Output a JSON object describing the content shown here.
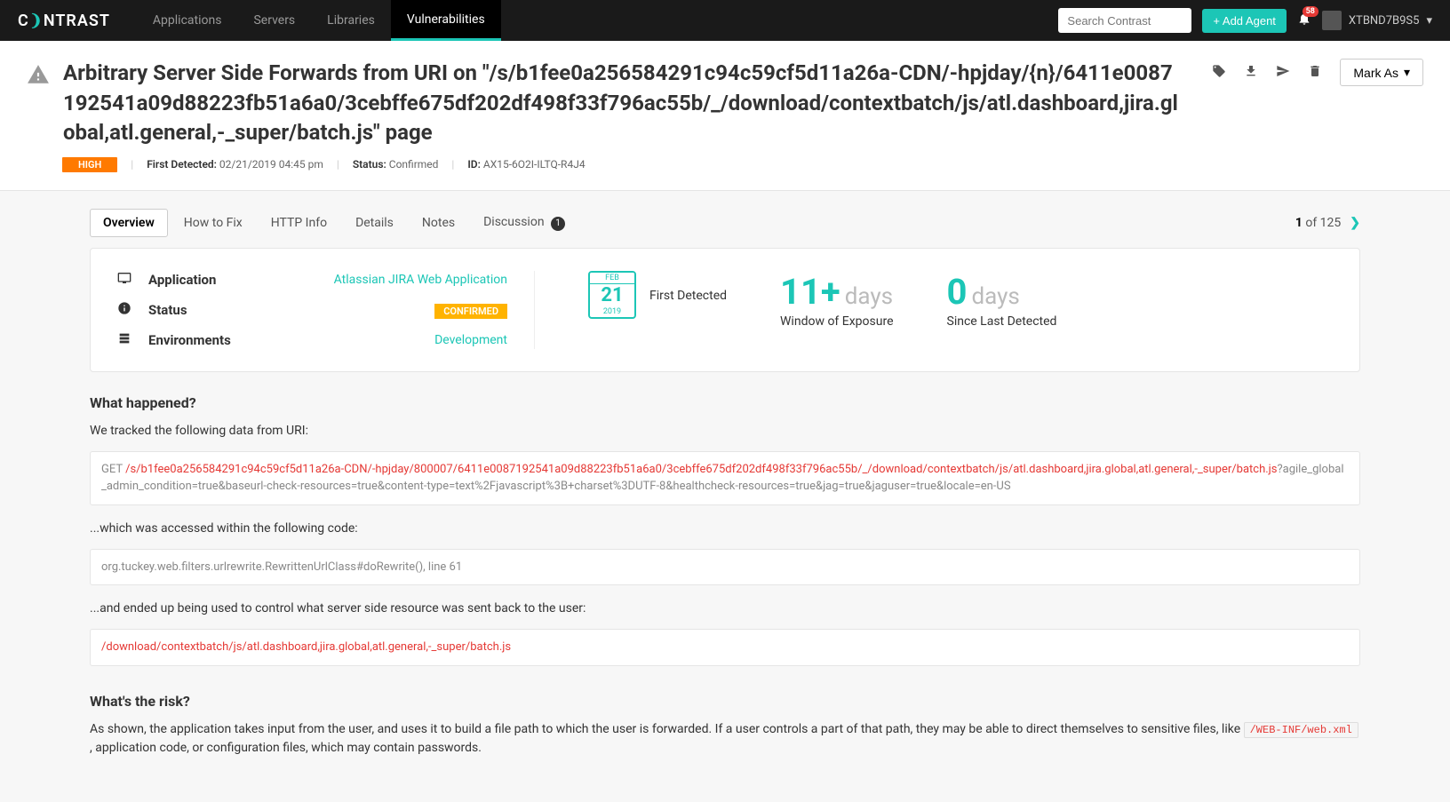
{
  "nav": {
    "logo_pre": "C",
    "logo_accent": "❩",
    "logo_post": "NTRAST",
    "items": [
      "Applications",
      "Servers",
      "Libraries",
      "Vulnerabilities"
    ],
    "active_index": 3,
    "search_placeholder": "Search Contrast",
    "add_agent": "+ Add Agent",
    "notif_count": "58",
    "username": "XTBND7B9S5"
  },
  "header": {
    "title": "Arbitrary Server Side Forwards from URI on \"/s/b1fee0a256584291c94c59cf5d11a26a-CDN/-hpjday/{n}/6411e0087192541a09d88223fb51a6a0/3cebffe675df202df498f33f796ac55b/_/download/contextbatch/js/atl.dashboard,jira.global,atl.general,-_super/batch.js\" page",
    "severity": "HIGH",
    "first_detected_label": "First Detected:",
    "first_detected_value": "02/21/2019 04:45 pm",
    "status_label": "Status:",
    "status_value": "Confirmed",
    "id_label": "ID:",
    "id_value": "AX15-6O2I-ILTQ-R4J4",
    "mark_as": "Mark As"
  },
  "tabs": {
    "items": [
      "Overview",
      "How to Fix",
      "HTTP Info",
      "Details",
      "Notes"
    ],
    "discussion_label": "Discussion",
    "discussion_count": "1",
    "active_index": 0,
    "pager_current": "1",
    "pager_of": " of 125"
  },
  "summary": {
    "app_label": "Application",
    "app_value": "Atlassian JIRA Web Application",
    "status_label": "Status",
    "status_value": "CONFIRMED",
    "env_label": "Environments",
    "env_value": "Development",
    "cal_month": "FEB",
    "cal_day": "21",
    "cal_year": "2019",
    "first_detected": "First Detected",
    "exposure_num": "11+",
    "exposure_unit": "days",
    "exposure_label": "Window of Exposure",
    "since_num": "0",
    "since_unit": "days",
    "since_label": "Since Last Detected"
  },
  "what_happened": {
    "heading": "What happened?",
    "intro": "We tracked the following data from URI:",
    "code1_pre": "GET ",
    "code1_red": "/s/b1fee0a256584291c94c59cf5d11a26a-CDN/-hpjday/800007/6411e0087192541a09d88223fb51a6a0/3cebffe675df202df498f33f796ac55b/_/download/contextbatch/js/atl.dashboard,jira.global,atl.general,-_super/batch.js",
    "code1_post": "?agile_global_admin_condition=true&baseurl-check-resources=true&content-type=text%2Fjavascript%3B+charset%3DUTF-8&healthcheck-resources=true&jag=true&jaguser=true&locale=en-US",
    "mid1": "...which was accessed within the following code:",
    "code2": "org.tuckey.web.filters.urlrewrite.RewrittenUrlClass#doRewrite(), line 61",
    "mid2": "...and ended up being used to control what server side resource was sent back to the user:",
    "code3": "/download/contextbatch/js/atl.dashboard,jira.global,atl.general,-_super/batch.js"
  },
  "risk": {
    "heading": "What's the risk?",
    "text_pre": "As shown, the application takes input from the user, and uses it to build a file path to which the user is forwarded. If a user controls a part of that path, they may be able to direct themselves to sensitive files, like ",
    "code": "/WEB-INF/web.xml",
    "text_post": " , application code, or configuration files, which may contain passwords."
  }
}
